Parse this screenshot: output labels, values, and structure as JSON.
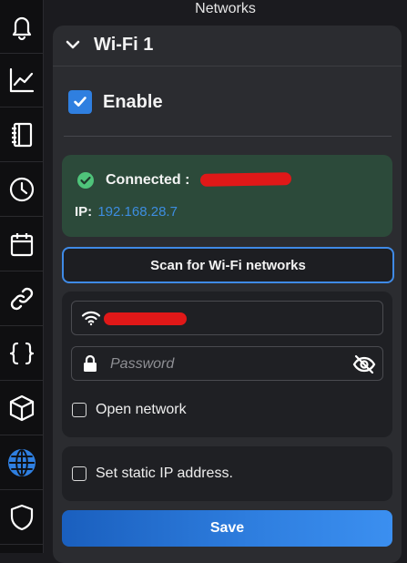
{
  "header": {
    "title": "Networks"
  },
  "sidebar": {
    "items": [
      {
        "icon": "bell-icon"
      },
      {
        "icon": "chart-line-icon"
      },
      {
        "icon": "notebook-icon"
      },
      {
        "icon": "clock-icon"
      },
      {
        "icon": "calendar-icon"
      },
      {
        "icon": "link-icon"
      },
      {
        "icon": "braces-icon"
      },
      {
        "icon": "cube-icon"
      },
      {
        "icon": "globe-icon",
        "active": true
      },
      {
        "icon": "shield-icon"
      }
    ]
  },
  "panel": {
    "title": "Wi-Fi 1",
    "enable_label": "Enable",
    "enabled": true,
    "status": {
      "label": "Connected :",
      "ip_label": "IP:",
      "ip_value": "192.168.28.7"
    },
    "scan_label": "Scan for Wi-Fi networks",
    "password_placeholder": "Password",
    "open_network_label": "Open network",
    "static_ip_label": "Set static IP address.",
    "save_label": "Save"
  },
  "colors": {
    "accent": "#2f7fe0",
    "status_bg": "#2c4a3a",
    "ok_green": "#4fc47a",
    "redaction": "#e01818"
  }
}
